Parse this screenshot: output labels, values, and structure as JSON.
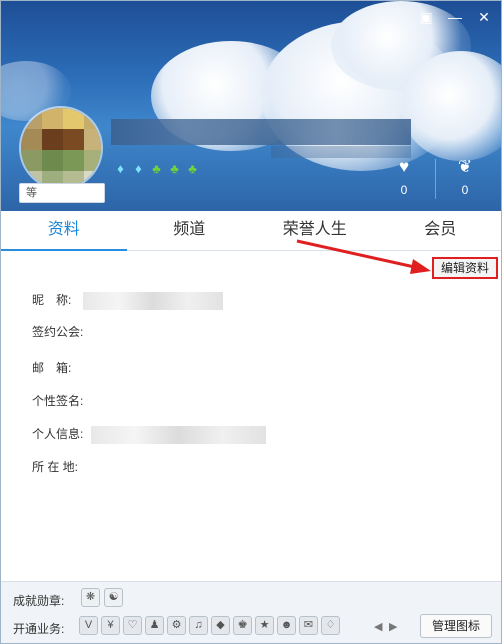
{
  "header": {
    "level_badge": "等",
    "stats": [
      {
        "icon": "heart-icon",
        "glyph": "♥",
        "value": "0"
      },
      {
        "icon": "ribbon-icon",
        "glyph": "❦",
        "value": "0"
      }
    ],
    "window_buttons": [
      {
        "name": "skin-icon",
        "glyph": "▣"
      },
      {
        "name": "minimize-icon",
        "glyph": "—"
      },
      {
        "name": "close-icon",
        "glyph": "✕"
      }
    ]
  },
  "tabs": [
    {
      "label": "资料",
      "active": true
    },
    {
      "label": "频道",
      "active": false
    },
    {
      "label": "荣誉人生",
      "active": false
    },
    {
      "label": "会员",
      "active": false
    }
  ],
  "edit_button": "编辑资料",
  "profile": {
    "nickname_label": "昵　称:",
    "guild_label": "签约公会:",
    "email_label": "邮　箱:",
    "signature_label": "个性签名:",
    "personal_label": "个人信息:",
    "location_label": "所 在 地:"
  },
  "bottom": {
    "medals_label": "成就勋章:",
    "business_label": "开通业务:",
    "manage_button": "管理图标",
    "prev_arrow": "◀",
    "next_arrow": "▶"
  },
  "colors": {
    "accent": "#1e86d6",
    "highlight_border": "#e02020"
  }
}
